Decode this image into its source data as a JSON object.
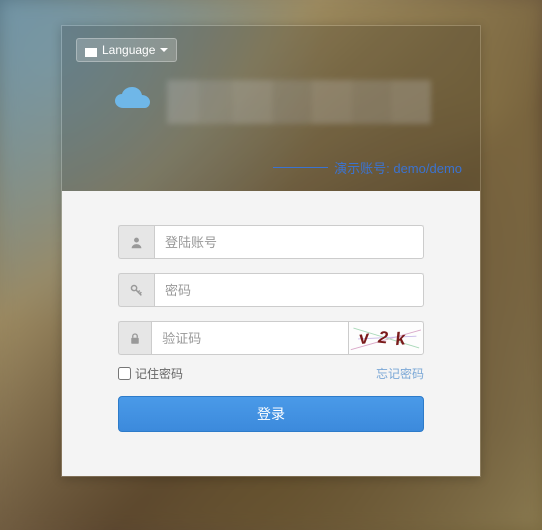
{
  "language": {
    "label": "Language"
  },
  "demo": {
    "text": "演示账号: demo/demo"
  },
  "form": {
    "username_placeholder": "登陆账号",
    "password_placeholder": "密码",
    "captcha_placeholder": "验证码",
    "captcha_text": "v2k",
    "remember_label": "记住密码",
    "forgot_label": "忘记密码",
    "login_label": "登录"
  }
}
